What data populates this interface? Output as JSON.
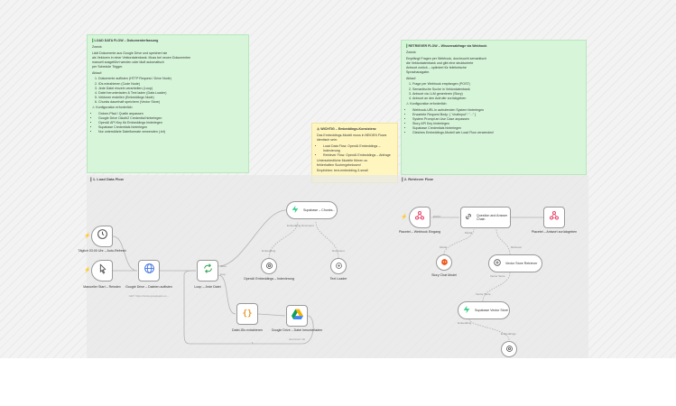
{
  "colors": {
    "sticky_green": "#d6f5d9",
    "sticky_yellow": "#fff6bf",
    "supabase_green": "#3ecf8e",
    "webhook_pink": "#e8436b",
    "google_blue": "#4285f4",
    "ollama_orange": "#f0581e",
    "trigger_orange": "#ff6d3a"
  },
  "notes": {
    "load": {
      "title": "LOAD DATA FLOW – Dokumenterfassung",
      "purpose_label": "Zweck:",
      "purpose": [
        "Lädt Dokumente aus Google Drive und speichert sie",
        "als Vektoren in einer Vektordatenbank. Muss bei neuen Dokumenten",
        "manuell ausgeführt werden oder läuft automatisch",
        "per Schedule Trigger."
      ],
      "process_label": "Ablauf:",
      "steps": [
        "Dokumente auflisten (HTTP Request / Drive Node)",
        "IDs extrahieren (Code Node)",
        "Jede Datei einzeln verarbeiten (Loop)",
        "Datei herunterladen & Text laden (Data Loader)",
        "Vektoren erstellen (Embeddings Node)",
        "Chunks dauerhaft speichern (Vector Store)"
      ],
      "config_label": "Konfiguration erforderlich:",
      "config": [
        "Ordner-Pfad / Quelle anpassen",
        "Google Drive OAuth2 Credential hinterlegen",
        "OpenAI API Key für Embeddings hinterlegen",
        "Supabase Credentials hinterlegen",
        "Nur unterstützte Dateiformate verwenden (.txt)"
      ]
    },
    "warning": {
      "title": "WICHTIG – Embeddings-Konsistenz",
      "intro": [
        "Das Embeddings-Modell muss in BEIDEN Flows",
        "identisch sein:"
      ],
      "items": [
        "Load Data Flow: OpenAI Embeddings – Indexierung",
        "Retriever Flow: OpenAI Embeddings – Abfrage"
      ],
      "outro": [
        "Unterschiedliche Modelle führen zu",
        "fehlerhaften Suchergebnissen!",
        "Empfohlen: text-embedding-3-small"
      ]
    },
    "retriever": {
      "title": "RETRIEVER FLOW – Wissensabfrage via Webhook",
      "purpose_label": "Zweck:",
      "purpose": [
        "Empfängt Fragen per Webhook, durchsucht semantisch",
        "die Vektordatenbank und gibt eine strukturierte",
        "Antwort zurück – optimiert für telefonische",
        "Sprachausgabe."
      ],
      "process_label": "Ablauf:",
      "steps": [
        "Frage per Webhook empfangen (POST)",
        "Semantische Suche in Vektordatenbank",
        "Antwort via LLM generieren (Story)",
        "Antwort an den Aufrufer zurückgeben"
      ],
      "config_label": "Konfiguration erforderlich:",
      "config": [
        "Webhook-URL in aufrufenden System hinterlegen",
        "Erwartete Request Body: { \"chatInput\": \"...\" }",
        "System Prompt an Use Case anpassen",
        "Story API Key hinterlegen",
        "Supabase Credentials hinterlegen",
        "Gleiches Embeddings-Modell wie Load Flow verwenden!"
      ]
    }
  },
  "groups": {
    "load": {
      "title": "1. Load Data Flow"
    },
    "retriever": {
      "title": "2. Retriever Flow"
    }
  },
  "nodes": {
    "schedule": {
      "label": "Täglich 03:00 Uhr – Auto-Refresh",
      "icon": "clock-icon"
    },
    "manual": {
      "label": "Manueller Start – Reindex",
      "icon": "cursor-click-icon"
    },
    "drive_list": {
      "label": "Google Drive – Dateien auflisten",
      "sub": "GET: https://www.googleapis.co...",
      "icon": "globe-icon"
    },
    "loop": {
      "label": "Loop – Jede Datei",
      "icon": "loop-icon",
      "port_done": "done",
      "port_loop": "loop"
    },
    "supabase_chunks": {
      "label": "Supabase – Chunks...",
      "icon": "supabase-icon",
      "port_label": "Embedding Document"
    },
    "embeddings_index": {
      "label": "OpenAI Embeddings – Indexierung",
      "port_label": "Embedding",
      "icon": "openai-icon"
    },
    "text_loader": {
      "label": "Text Loader",
      "port_label": "Document",
      "icon": "loader-icon"
    },
    "extract_ids": {
      "label": "Datei-IDs extrahieren",
      "icon": "code-braces-icon"
    },
    "drive_download": {
      "label": "Google Drive – Datei herunterladen",
      "sub": "download: file",
      "icon": "google-drive-icon"
    },
    "webhook_in": {
      "label": "Placetel – Webhook Eingang",
      "icon": "webhook-icon",
      "edge_label": "POST"
    },
    "question_chain": {
      "label": "Question and Answer Chain",
      "icon": "chain-icon"
    },
    "webhook_out": {
      "label": "Placetel – Antwort zurückgeben",
      "icon": "webhook-icon"
    },
    "ollama": {
      "label": "Story Chat Model",
      "icon": "ollama-icon"
    },
    "vs_retriever": {
      "label": "Vector Store Retriever",
      "icon": "vector-store-icon"
    },
    "supabase_store": {
      "label": "Supabase Vector Store",
      "icon": "supabase-icon"
    },
    "embeddings_query": {
      "label": "",
      "icon": "openai-icon"
    }
  },
  "edge_labels": {
    "model": "Model",
    "retriever": "Retriever",
    "vector_store": "Vector Store",
    "embedding": "Embedding",
    "embeddings": "Embeddings",
    "count": "1"
  }
}
